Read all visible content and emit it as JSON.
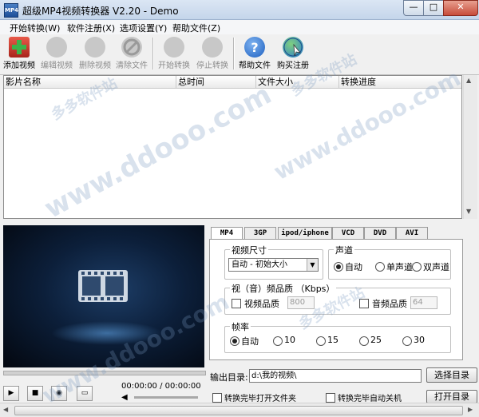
{
  "window": {
    "title": "超级MP4视频转换器 V2.20 - Demo",
    "icon": "app-logo-icon",
    "controls": {
      "minimize": "minimize-icon",
      "maximize": "maximize-icon",
      "close": "close-icon"
    }
  },
  "menu": [
    "开始转换(W)",
    "软件注册(X)",
    "选项设置(Y)",
    "帮助文件(Z)"
  ],
  "toolbar": {
    "add": "添加视频",
    "edit": "编辑视频",
    "delete": "删除视频",
    "clear": "清除文件",
    "start": "开始转换",
    "stop": "停止转换",
    "help": "帮助文件",
    "buy": "购买注册"
  },
  "list": {
    "columns": [
      "影片名称",
      "总时间",
      "文件大小",
      "转换进度"
    ],
    "rows": []
  },
  "tabs": [
    "MP4",
    "3GP",
    "ipod/iphone",
    "VCD",
    "DVD",
    "AVI"
  ],
  "active_tab": "MP4",
  "panel": {
    "size_group": "视频尺寸",
    "size_value": "自动 - 初始大小",
    "audio_channel_group": "声道",
    "channels": [
      "自动",
      "单声道",
      "双声道"
    ],
    "channel_selected": "自动",
    "quality_group": "视（音）频品质 （Kbps）",
    "video_quality_label": "视频品质",
    "video_quality_value": "800",
    "audio_quality_label": "音频品质",
    "audio_quality_value": "64",
    "fps_group": "帧率",
    "fps_options": [
      "自动",
      "10",
      "15",
      "25",
      "30"
    ],
    "fps_selected": "自动"
  },
  "output": {
    "label": "输出目录:",
    "path": "d:\\我的视频\\",
    "browse_button": "选择目录",
    "open_folder_check": "转换完毕打开文件夹",
    "shutdown_check": "转换完毕自动关机",
    "open_button": "打开目录"
  },
  "player": {
    "time": "00:00:00 / 00:00:00"
  },
  "watermark": [
    "多多软件站",
    "www.ddooo.com"
  ]
}
